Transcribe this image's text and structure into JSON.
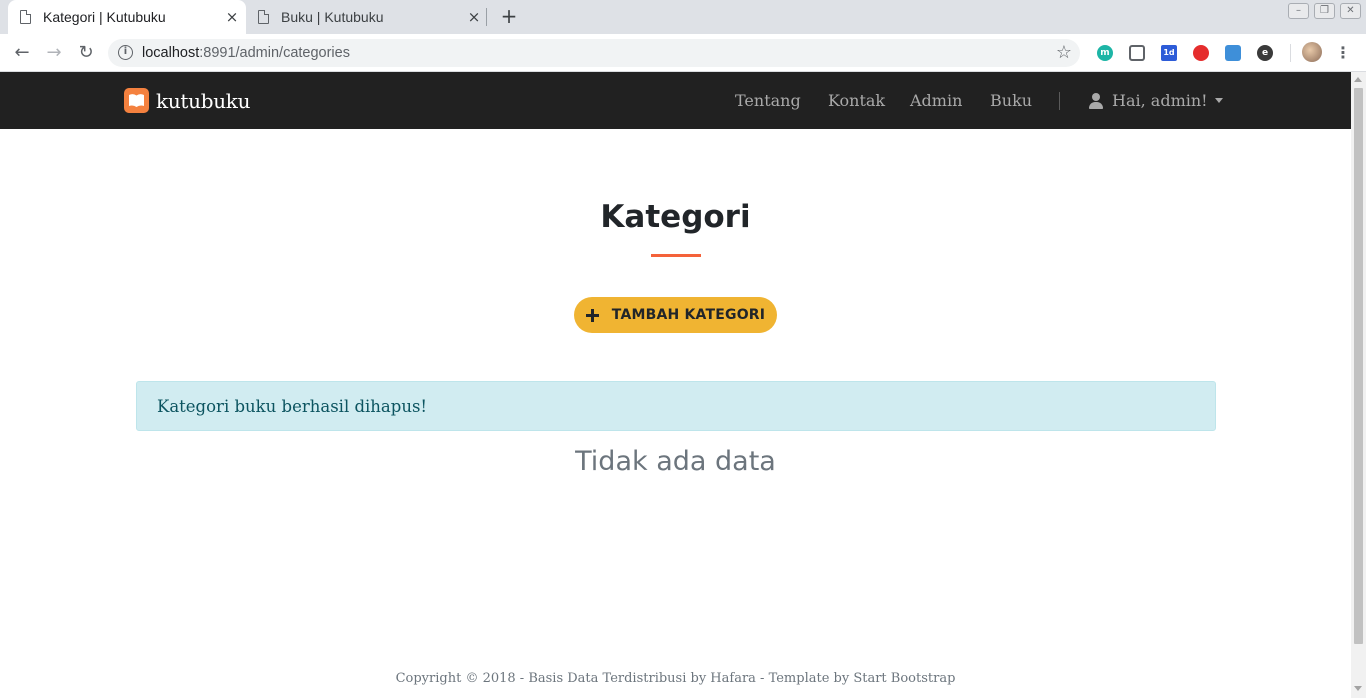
{
  "browser": {
    "tabs": [
      {
        "title": "Kategori | Kutubuku",
        "active": true
      },
      {
        "title": "Buku | Kutubuku",
        "active": false
      }
    ],
    "tab_close_glyph": "×",
    "new_tab_glyph": "+",
    "url_host": "localhost",
    "url_path": ":8991/admin/categories",
    "extensions": [
      {
        "name": "meet-extension-icon",
        "color": "#1db5a6",
        "label": "m"
      },
      {
        "name": "chat-extension-icon",
        "color": "#5f6368",
        "label": ""
      },
      {
        "name": "calendar-extension-icon",
        "color": "#2d5cd8",
        "label": "1d"
      },
      {
        "name": "opera-extension-icon",
        "color": "#e52d2d",
        "label": ""
      },
      {
        "name": "translate-extension-icon",
        "color": "#3e8fd9",
        "label": ""
      },
      {
        "name": "edge-extension-icon",
        "color": "#3a3a3a",
        "label": "e"
      }
    ]
  },
  "site": {
    "brand": "kutubuku",
    "brand_color": "#f4813f",
    "nav_links": [
      "Tentang",
      "Kontak",
      "Admin",
      "Buku"
    ],
    "user_greeting": "Hai, admin!"
  },
  "main": {
    "title": "Kategori",
    "accent_color": "#f4623a",
    "add_button_label": "TAMBAH KATEGORI",
    "alert_message": "Kategori buku berhasil dihapus!",
    "empty_message": "Tidak ada data"
  },
  "footer": {
    "text": "Copyright © 2018 - Basis Data Terdistribusi by Hafara - Template by Start Bootstrap"
  }
}
